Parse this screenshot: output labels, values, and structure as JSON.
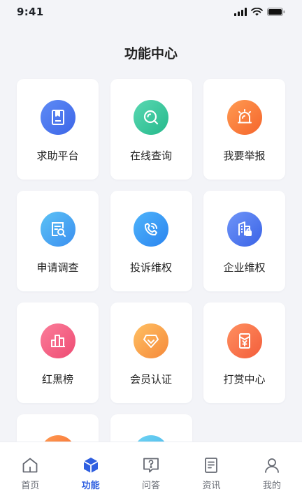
{
  "status": {
    "time": "9:41"
  },
  "title": "功能中心",
  "features": [
    {
      "label": "求助平台",
      "icon": "bookmark-book-icon",
      "color": "#4a78f0"
    },
    {
      "label": "在线查询",
      "icon": "search-icon",
      "color": "#2fc497"
    },
    {
      "label": "我要举报",
      "icon": "alarm-light-icon",
      "color": "#f7743a"
    },
    {
      "label": "申请调查",
      "icon": "document-search-icon",
      "color": "#4aa6f2"
    },
    {
      "label": "投诉维权",
      "icon": "phone-complaint-icon",
      "color": "#3a95f2"
    },
    {
      "label": "企业维权",
      "icon": "building-lock-icon",
      "color": "#4a74ef"
    },
    {
      "label": "红黑榜",
      "icon": "ranking-chart-icon",
      "color": "#f25d80"
    },
    {
      "label": "会员认证",
      "icon": "diamond-badge-icon",
      "color": "#f7a045"
    },
    {
      "label": "打赏中心",
      "icon": "red-envelope-yuan-icon",
      "color": "#f56c44"
    }
  ],
  "tabbar": [
    {
      "label": "首页",
      "icon": "home-icon",
      "active": false
    },
    {
      "label": "功能",
      "icon": "cube-icon",
      "active": true
    },
    {
      "label": "问答",
      "icon": "question-bubble-icon",
      "active": false
    },
    {
      "label": "资讯",
      "icon": "news-document-icon",
      "active": false
    },
    {
      "label": "我的",
      "icon": "user-icon",
      "active": false
    }
  ],
  "colors": {
    "accent": "#2f5fe0",
    "background": "#f3f4f8",
    "tab_inactive": "#666a73"
  }
}
